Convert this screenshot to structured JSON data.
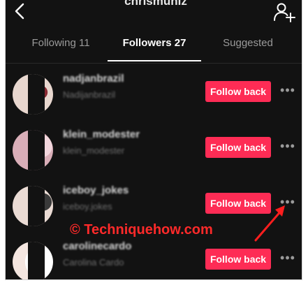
{
  "header": {
    "username": "chrismuniz",
    "back_icon": "chevron-left-icon",
    "add_user_icon": "add-user-icon"
  },
  "tabs": [
    {
      "label": "Following 11",
      "active": false
    },
    {
      "label": "Followers 27",
      "active": true
    },
    {
      "label": "Suggested",
      "active": false
    }
  ],
  "followers": [
    {
      "name": "nadjanbrazil",
      "handle": "Nadijanbrazil",
      "button": "Follow back"
    },
    {
      "name": "klein_modester",
      "handle": "klein_modester",
      "button": "Follow back"
    },
    {
      "name": "iceboy_jokes",
      "handle": "iceboy.jokes",
      "button": "Follow back"
    },
    {
      "name": "carolinecardo",
      "handle": "Carolina Cardo",
      "button": "Follow back"
    }
  ],
  "more_label": "•••",
  "watermark": {
    "text": "© Techniquehow.com",
    "color": "#ff2a2a"
  },
  "colors": {
    "background": "#121212",
    "accent": "#fe2c55",
    "text": "#ffffff",
    "muted": "#9a9a9a"
  }
}
